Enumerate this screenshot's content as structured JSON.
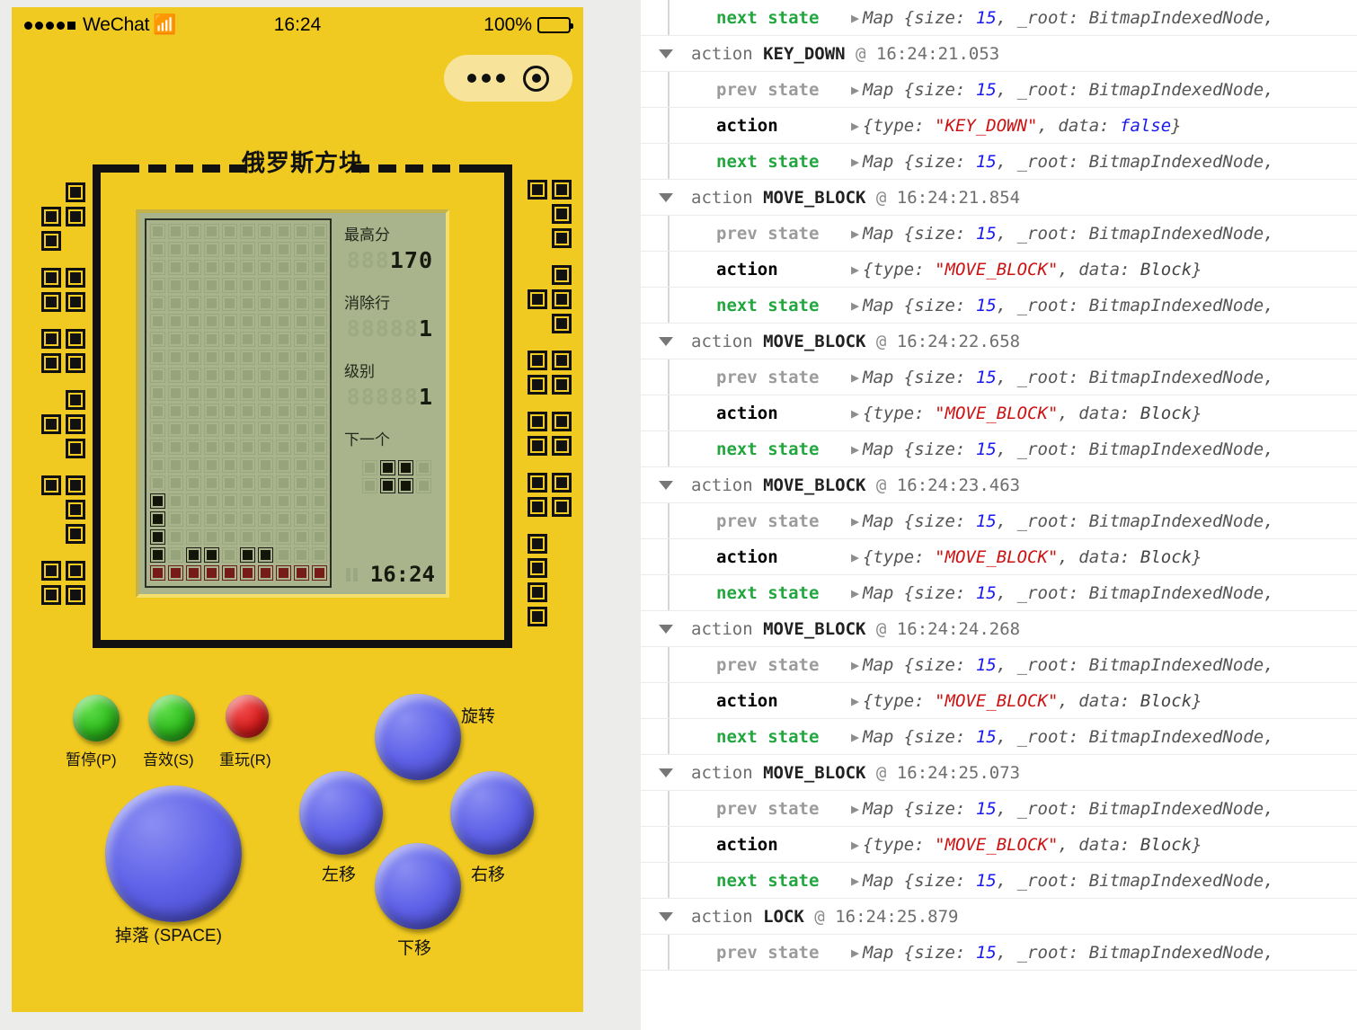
{
  "phone": {
    "status_bar": {
      "carrier": "WeChat",
      "wifi_icon": "wifi-icon",
      "time": "16:24",
      "battery_pct": "100%",
      "battery_icon": "battery-full-icon"
    },
    "capsule": {
      "menu_icon": "more-dots-icon",
      "close_icon": "target-circle-icon"
    }
  },
  "game": {
    "title": "俄罗斯方块",
    "info": {
      "high_score_label": "最高分",
      "high_score_ghost": "888",
      "high_score_value": "170",
      "lines_label": "消除行",
      "lines_ghost": "88888",
      "lines_value": "1",
      "level_label": "级别",
      "level_ghost": "88888",
      "level_value": "1",
      "next_label": "下一个",
      "clock": "16:24",
      "pause_icon": "pause-bars-icon"
    },
    "board": {
      "cols": 10,
      "rows": 20,
      "filled_cells": [
        [
          16,
          0
        ],
        [
          17,
          0
        ],
        [
          18,
          0
        ],
        [
          19,
          0
        ],
        [
          19,
          2
        ],
        [
          19,
          3
        ],
        [
          19,
          5
        ],
        [
          19,
          6
        ]
      ],
      "clearing_row_cells": [
        [
          20,
          0
        ],
        [
          20,
          1
        ],
        [
          20,
          2
        ],
        [
          20,
          3
        ],
        [
          20,
          4
        ],
        [
          20,
          5
        ],
        [
          20,
          6
        ],
        [
          20,
          7
        ],
        [
          20,
          8
        ],
        [
          20,
          9
        ]
      ],
      "next_piece_cells": [
        [
          0,
          1
        ],
        [
          0,
          2
        ],
        [
          1,
          1
        ],
        [
          1,
          2
        ]
      ]
    },
    "buttons": {
      "pause": "暂停(P)",
      "sound": "音效(S)",
      "restart": "重玩(R)",
      "drop": "掉落 (SPACE)",
      "rotate": "旋转",
      "left": "左移",
      "right": "右移",
      "down": "下移"
    },
    "colors": {
      "case": "#f0c921",
      "lcd": "#a9b48c",
      "block": "#141509",
      "clearing": "#771b18",
      "button_blue": "#5f62e8",
      "button_green": "#2fbe1d",
      "button_red": "#e01f1f"
    }
  },
  "devtools": {
    "labels": {
      "action": "action",
      "prev_state": "prev state",
      "next_state": "next state",
      "at_sign": "@",
      "caret_icon": "chevron-down-icon",
      "expander_icon": "expand-arrow-icon"
    },
    "state_value_prefix": "Map {size:",
    "state_value_size": "15",
    "state_value_suffix": ", _root: BitmapIndexedNode,",
    "entries": [
      {
        "partial_top": true,
        "rows": [
          {
            "kind": "next",
            "value_type": "map"
          }
        ]
      },
      {
        "action_name": "KEY_DOWN",
        "timestamp": "16:24:21.053",
        "rows": [
          {
            "kind": "prev",
            "value_type": "map"
          },
          {
            "kind": "action",
            "value_type": "action",
            "type_str": "KEY_DOWN",
            "data_label": "data:",
            "data_val": "false",
            "data_kind": "bool"
          },
          {
            "kind": "next",
            "value_type": "map"
          }
        ]
      },
      {
        "action_name": "MOVE_BLOCK",
        "timestamp": "16:24:21.854",
        "rows": [
          {
            "kind": "prev",
            "value_type": "map"
          },
          {
            "kind": "action",
            "value_type": "action",
            "type_str": "MOVE_BLOCK",
            "data_label": "data:",
            "data_val": "Block",
            "data_kind": "plain"
          },
          {
            "kind": "next",
            "value_type": "map"
          }
        ]
      },
      {
        "action_name": "MOVE_BLOCK",
        "timestamp": "16:24:22.658",
        "rows": [
          {
            "kind": "prev",
            "value_type": "map"
          },
          {
            "kind": "action",
            "value_type": "action",
            "type_str": "MOVE_BLOCK",
            "data_label": "data:",
            "data_val": "Block",
            "data_kind": "plain"
          },
          {
            "kind": "next",
            "value_type": "map"
          }
        ]
      },
      {
        "action_name": "MOVE_BLOCK",
        "timestamp": "16:24:23.463",
        "rows": [
          {
            "kind": "prev",
            "value_type": "map"
          },
          {
            "kind": "action",
            "value_type": "action",
            "type_str": "MOVE_BLOCK",
            "data_label": "data:",
            "data_val": "Block",
            "data_kind": "plain"
          },
          {
            "kind": "next",
            "value_type": "map"
          }
        ]
      },
      {
        "action_name": "MOVE_BLOCK",
        "timestamp": "16:24:24.268",
        "rows": [
          {
            "kind": "prev",
            "value_type": "map"
          },
          {
            "kind": "action",
            "value_type": "action",
            "type_str": "MOVE_BLOCK",
            "data_label": "data:",
            "data_val": "Block",
            "data_kind": "plain"
          },
          {
            "kind": "next",
            "value_type": "map"
          }
        ]
      },
      {
        "action_name": "MOVE_BLOCK",
        "timestamp": "16:24:25.073",
        "rows": [
          {
            "kind": "prev",
            "value_type": "map"
          },
          {
            "kind": "action",
            "value_type": "action",
            "type_str": "MOVE_BLOCK",
            "data_label": "data:",
            "data_val": "Block",
            "data_kind": "plain"
          },
          {
            "kind": "next",
            "value_type": "map"
          }
        ]
      },
      {
        "action_name": "LOCK",
        "timestamp": "16:24:25.879",
        "rows": [
          {
            "kind": "prev",
            "value_type": "map"
          }
        ]
      }
    ]
  },
  "decorations": {
    "left_pieces": [
      "S",
      "O",
      "O",
      "T",
      "J",
      "O"
    ],
    "right_pieces": [
      "J",
      "T",
      "O",
      "O",
      "O",
      "I"
    ]
  }
}
